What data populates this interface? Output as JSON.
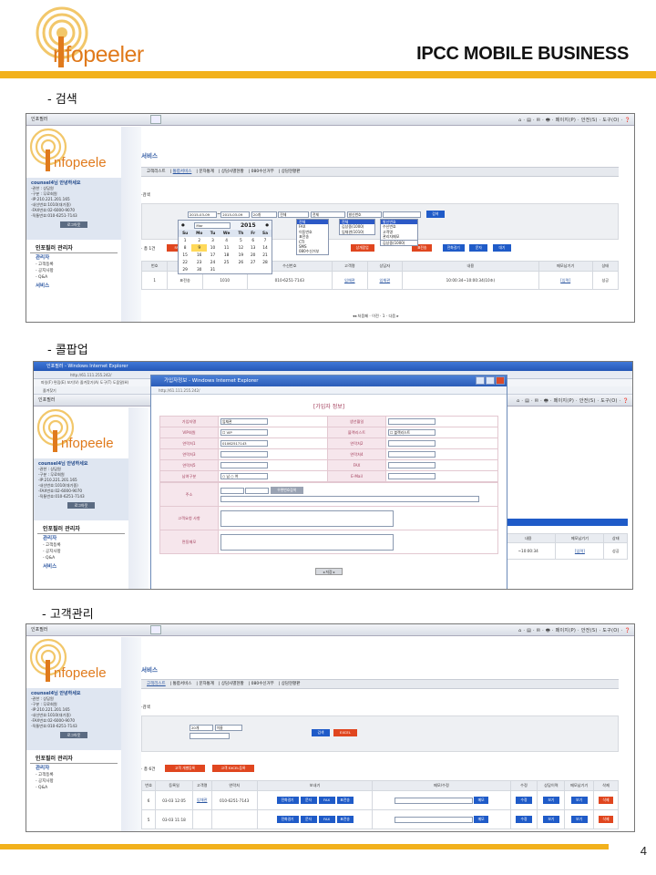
{
  "header": {
    "logo_text": "nfopeeler",
    "title": "IPCC MOBILE BUSINESS"
  },
  "sections": [
    "- 검색",
    "- 콜팝업",
    "- 고객관리"
  ],
  "page_number": "4",
  "browser": {
    "tab_title": "인포필러",
    "tools": "⌂ · ▤ · ✉ · 🖶 · 페이지(P) · 안전(S) · 도구(O) · ❓",
    "address": "http://61.111.255.242/",
    "menu": "파일(F) 편집(E) 보기(V) 즐겨찾기(A) 도구(T) 도움말(H)",
    "favorites": "즐겨찾기",
    "ie_title": "인포필러 - Windows Internet Explorer"
  },
  "sidebar": {
    "logo_text": "nfopeele",
    "welcome": "counsel4님 안녕하세요",
    "info": [
      "-권한 : 상담원",
      "-구분 : 무료회원",
      "-IP:210.221.201.165",
      "-내선번호:1010(대기중)",
      "-FAX번호:02-6000-9070",
      "-직통번호:010-6251-7143"
    ],
    "logout": "로그아웃",
    "admin_title": "인포필러 관리자",
    "nav_head": "관리자",
    "nav": [
      "- 고객등록",
      "- 공지사항",
      "- Q&A"
    ],
    "service": "서비스"
  },
  "main": {
    "service_title": "서비스",
    "tabs": [
      "고객리스트",
      "통합서비스",
      "문자통계",
      "상담사별현황",
      "080수신거부",
      "상담현황판"
    ],
    "search_label": "·검색"
  },
  "search_shot": {
    "date_from": "2015-03-09",
    "date_to": "2015-03-09",
    "sel1": "20개",
    "sel2": "전체",
    "sel3": "전체",
    "sel4": "발신번호",
    "search_btn": "검색",
    "total": "· 총 1건",
    "fax_btn": "FAX",
    "buttons": [
      "상개팝업",
      "표전송",
      "전화걸기",
      "문자",
      "대기"
    ],
    "calendar": {
      "month": "Mar",
      "year": "2015",
      "dow": [
        "Su",
        "Mo",
        "Tu",
        "We",
        "Th",
        "Fr",
        "Sa"
      ],
      "weeks": [
        [
          "1",
          "2",
          "3",
          "4",
          "5",
          "6",
          "7"
        ],
        [
          "8",
          "9",
          "10",
          "11",
          "12",
          "13",
          "14"
        ],
        [
          "15",
          "16",
          "17",
          "18",
          "19",
          "20",
          "21"
        ],
        [
          "22",
          "23",
          "24",
          "25",
          "26",
          "27",
          "28"
        ],
        [
          "29",
          "30",
          "31",
          "",
          "",
          "",
          ""
        ]
      ],
      "today": "9"
    },
    "dd1": [
      "전체",
      "FAX",
      "이동번호",
      "표전송",
      "CTI",
      "SMS",
      "080수신거부"
    ],
    "dd2": [
      "전체",
      "김상중(1000)",
      "임채관(1010)"
    ],
    "dd3": [
      "발신번호",
      "수신번호",
      "고객명",
      "관리자메모"
    ],
    "dd3_footer": "김상중(1000)",
    "columns": [
      "번호",
      "구분",
      "발신번호",
      "수신번호",
      "고객명",
      "상담자",
      "내용",
      "메모남기기",
      "상태"
    ],
    "row": [
      "1",
      "",
      "1010",
      "010-6251-7143",
      "임채관",
      "임채관",
      "10:00:34~10:00:34(10초)",
      "[입력]",
      "성공"
    ],
    "row_extra": "표전송",
    "pager": "◂◂ 처음페 · 이전 · 1 · 다음 ▸"
  },
  "popup_shot": {
    "title": "가입자정보 - Windows Internet Explorer",
    "url": "http://61.111.255.242/",
    "form_title": "[가입자 정보]",
    "fields": [
      {
        "k1": "가입자명",
        "v1": "임채관",
        "k2": "생년월일",
        "v2": ""
      },
      {
        "k1": "VIP회원",
        "v1": "☐ VIP",
        "k2": "블랙리스트",
        "v2": "☐ 블랙리스트"
      },
      {
        "k1": "연락처1",
        "v1": "01062517143",
        "k2": "연락처2",
        "v2": ""
      },
      {
        "k1": "연락처3",
        "v1": "",
        "k2": "연락처4",
        "v2": ""
      },
      {
        "k1": "연락처5",
        "v1": "",
        "k2": "FAX",
        "v2": ""
      },
      {
        "k1": "남여구분",
        "v1": "○ 남  ○ 여",
        "k2": "E-Mail",
        "v2": ""
      }
    ],
    "address_label": "주소",
    "zip_btn": "우편번호검색",
    "memo_label": "고객요청 사항",
    "memo2_label": "면동메모",
    "save_btn": "◂ 저장 ▸",
    "bg_rows": [
      "~10:00:34",
      "[입력]",
      "성공"
    ],
    "bg_headers": [
      "내용",
      "메모남기기",
      "상태"
    ]
  },
  "customer_shot": {
    "sel1": "20개",
    "sel2": "이름",
    "search_btn": "검색",
    "excel_btn": "EXCEL",
    "total": "· 총 6건",
    "reg_btn": "고객 개별등록",
    "excel_reg_btn": "고객 EXCEL등록",
    "columns": [
      "번호",
      "등록일",
      "고객명",
      "연락처",
      "보내기",
      "메모/수정",
      "수정",
      "상담이력",
      "메모남기기",
      "삭제"
    ],
    "rows": [
      {
        "no": "6",
        "date": "03-03 12:05",
        "name": "임채관",
        "phone": "010-6251-7143"
      },
      {
        "no": "5",
        "date": "03-03 11:18",
        "name": "",
        "phone": ""
      }
    ],
    "send_buttons": [
      "전화걸기",
      "문자",
      "FAX",
      "표전송"
    ],
    "memo_btn": "메모",
    "edit_btn": "수정",
    "view_btn": "보기",
    "view2_btn": "보기",
    "delete_btn": "삭제"
  }
}
